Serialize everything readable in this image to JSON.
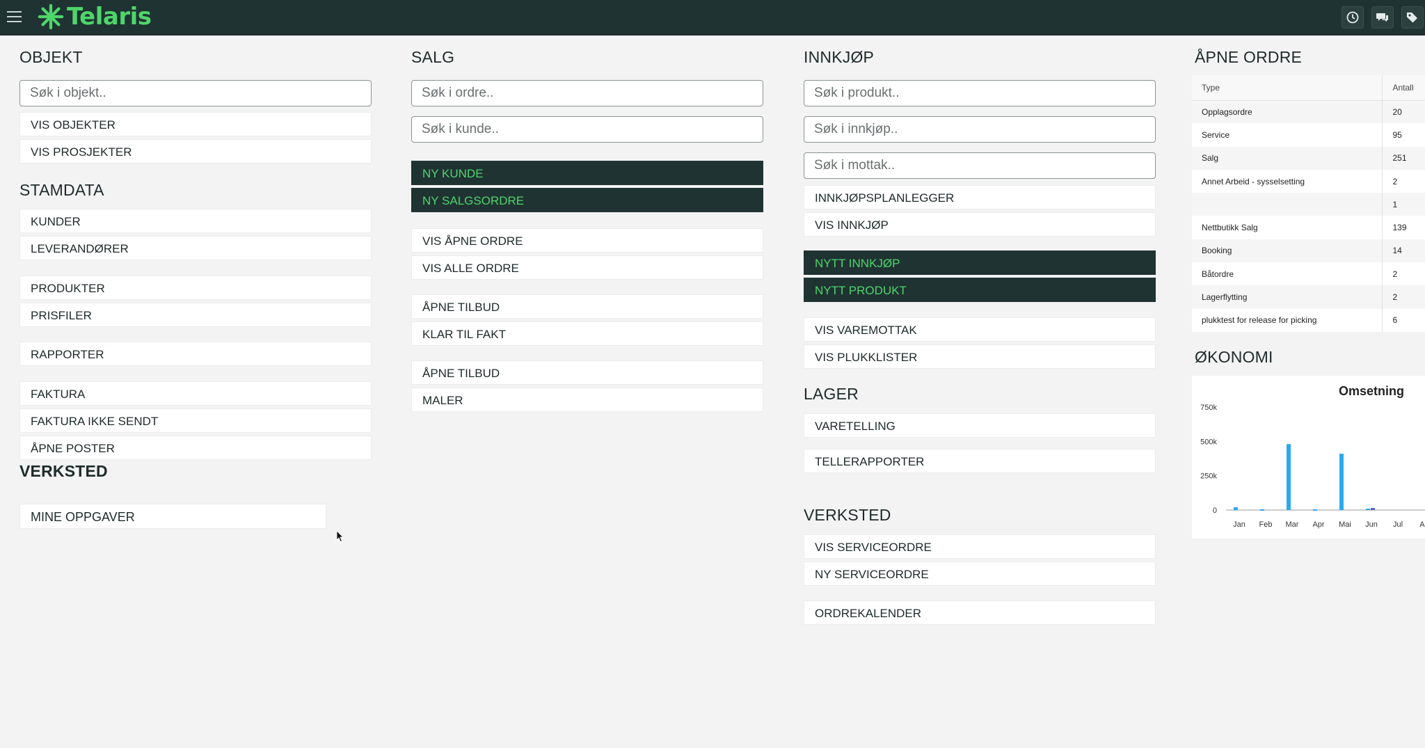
{
  "header": {
    "brand": "Telaris",
    "brand_color": "#4fd66b",
    "icons": [
      "clock-icon",
      "chat-icon",
      "tags-icon"
    ]
  },
  "objekt": {
    "title": "OBJEKT",
    "search_placeholder": "Søk i objekt..",
    "items": [
      "VIS OBJEKTER",
      "VIS PROSJEKTER"
    ]
  },
  "stamdata": {
    "title": "STAMDATA",
    "items": [
      "KUNDER",
      "LEVERANDØRER",
      "PRODUKTER",
      "PRISFILER",
      "RAPPORTER",
      "FAKTURA",
      "FAKTURA IKKE SENDT",
      "ÅPNE POSTER"
    ]
  },
  "verksted_left": {
    "title": "VERKSTED",
    "items": [
      "MINE OPPGAVER"
    ]
  },
  "salg": {
    "title": "SALG",
    "search_order_placeholder": "Søk i ordre..",
    "search_customer_placeholder": "Søk i kunde..",
    "primary_actions": [
      "NY KUNDE",
      "NY SALGSORDRE"
    ],
    "items": [
      "VIS ÅPNE ORDRE",
      "VIS ALLE ORDRE",
      "ÅPNE TILBUD",
      "KLAR TIL FAKT",
      "ÅPNE TILBUD",
      "MALER"
    ]
  },
  "innkjop": {
    "title": "INNKJØP",
    "search_product_placeholder": "Søk i produkt..",
    "search_purchase_placeholder": "Søk i innkjøp..",
    "search_receipt_placeholder": "Søk i mottak..",
    "items_top": [
      "INNKJØPSPLANLEGGER",
      "VIS INNKJØP"
    ],
    "primary_actions": [
      "NYTT INNKJØP",
      "NYTT PRODUKT"
    ],
    "items_bottom": [
      "VIS VAREMOTTAK",
      "VIS PLUKKLISTER"
    ]
  },
  "lager": {
    "title": "LAGER",
    "items": [
      "VARETELLING",
      "TELLERAPPORTER"
    ]
  },
  "verksted_right": {
    "title": "VERKSTED",
    "items": [
      "VIS SERVICEORDRE",
      "NY SERVICEORDRE",
      "ORDREKALENDER"
    ]
  },
  "open_orders": {
    "title": "ÅPNE ORDRE",
    "columns": [
      "Type",
      "Antall"
    ],
    "rows": [
      [
        "Opplagsordre",
        "20"
      ],
      [
        "Service",
        "95"
      ],
      [
        "Salg",
        "251"
      ],
      [
        "Annet Arbeid - sysselsetting",
        "2"
      ],
      [
        "",
        "1"
      ],
      [
        "Nettbutikk Salg",
        "139"
      ],
      [
        "Booking",
        "14"
      ],
      [
        "Båtordre",
        "2"
      ],
      [
        "Lagerflytting",
        "2"
      ],
      [
        "plukktest for release for picking",
        "6"
      ]
    ]
  },
  "okonomi": {
    "title": "ØKONOMI"
  },
  "chart_data": {
    "type": "bar",
    "title": "Omsetning",
    "categories": [
      "Jan",
      "Feb",
      "Mar",
      "Apr",
      "Mai",
      "Jun",
      "Jul",
      "Au"
    ],
    "y_ticks": [
      "0",
      "250k",
      "500k",
      "750k"
    ],
    "ylim": [
      0,
      750000
    ],
    "series": [
      {
        "color": "#2aa8f0",
        "values": [
          20000,
          5000,
          480000,
          5000,
          410000,
          10000,
          0,
          0
        ]
      },
      {
        "color": "#5a5fd6",
        "values": [
          0,
          0,
          0,
          0,
          0,
          15000,
          0,
          0
        ]
      }
    ]
  }
}
